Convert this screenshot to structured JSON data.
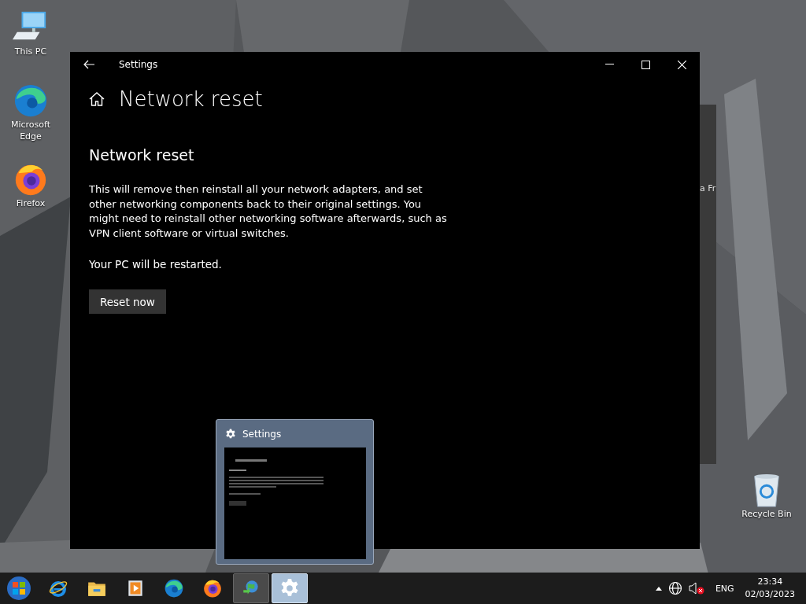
{
  "desktop_icons": [
    {
      "label": "This PC",
      "kind": "computer"
    },
    {
      "label": "Microsoft Edge",
      "kind": "edge"
    },
    {
      "label": "Firefox",
      "kind": "firefox"
    },
    {
      "label": "Recycle Bin",
      "kind": "recycle"
    }
  ],
  "background_window": {
    "text": "a Fr"
  },
  "window": {
    "title": "Settings",
    "page_title": "Network reset",
    "section_title": "Network reset",
    "description": "This will remove then reinstall all your network adapters, and set other networking components back to their original settings. You might need to reinstall other networking software afterwards, such as VPN client software or virtual switches.",
    "note": "Your PC will be restarted.",
    "button": "Reset now"
  },
  "thumbnail": {
    "title": "Settings"
  },
  "taskbar": {
    "items": [
      {
        "kind": "ie",
        "running": false,
        "selected": false
      },
      {
        "kind": "folder",
        "running": false,
        "selected": false
      },
      {
        "kind": "media",
        "running": false,
        "selected": false
      },
      {
        "kind": "edge",
        "running": false,
        "selected": false
      },
      {
        "kind": "firefox",
        "running": false,
        "selected": false
      },
      {
        "kind": "download",
        "running": true,
        "selected": false
      },
      {
        "kind": "settings",
        "running": true,
        "selected": true
      }
    ],
    "language": "ENG",
    "time": "23:34",
    "date": "02/03/2023"
  }
}
